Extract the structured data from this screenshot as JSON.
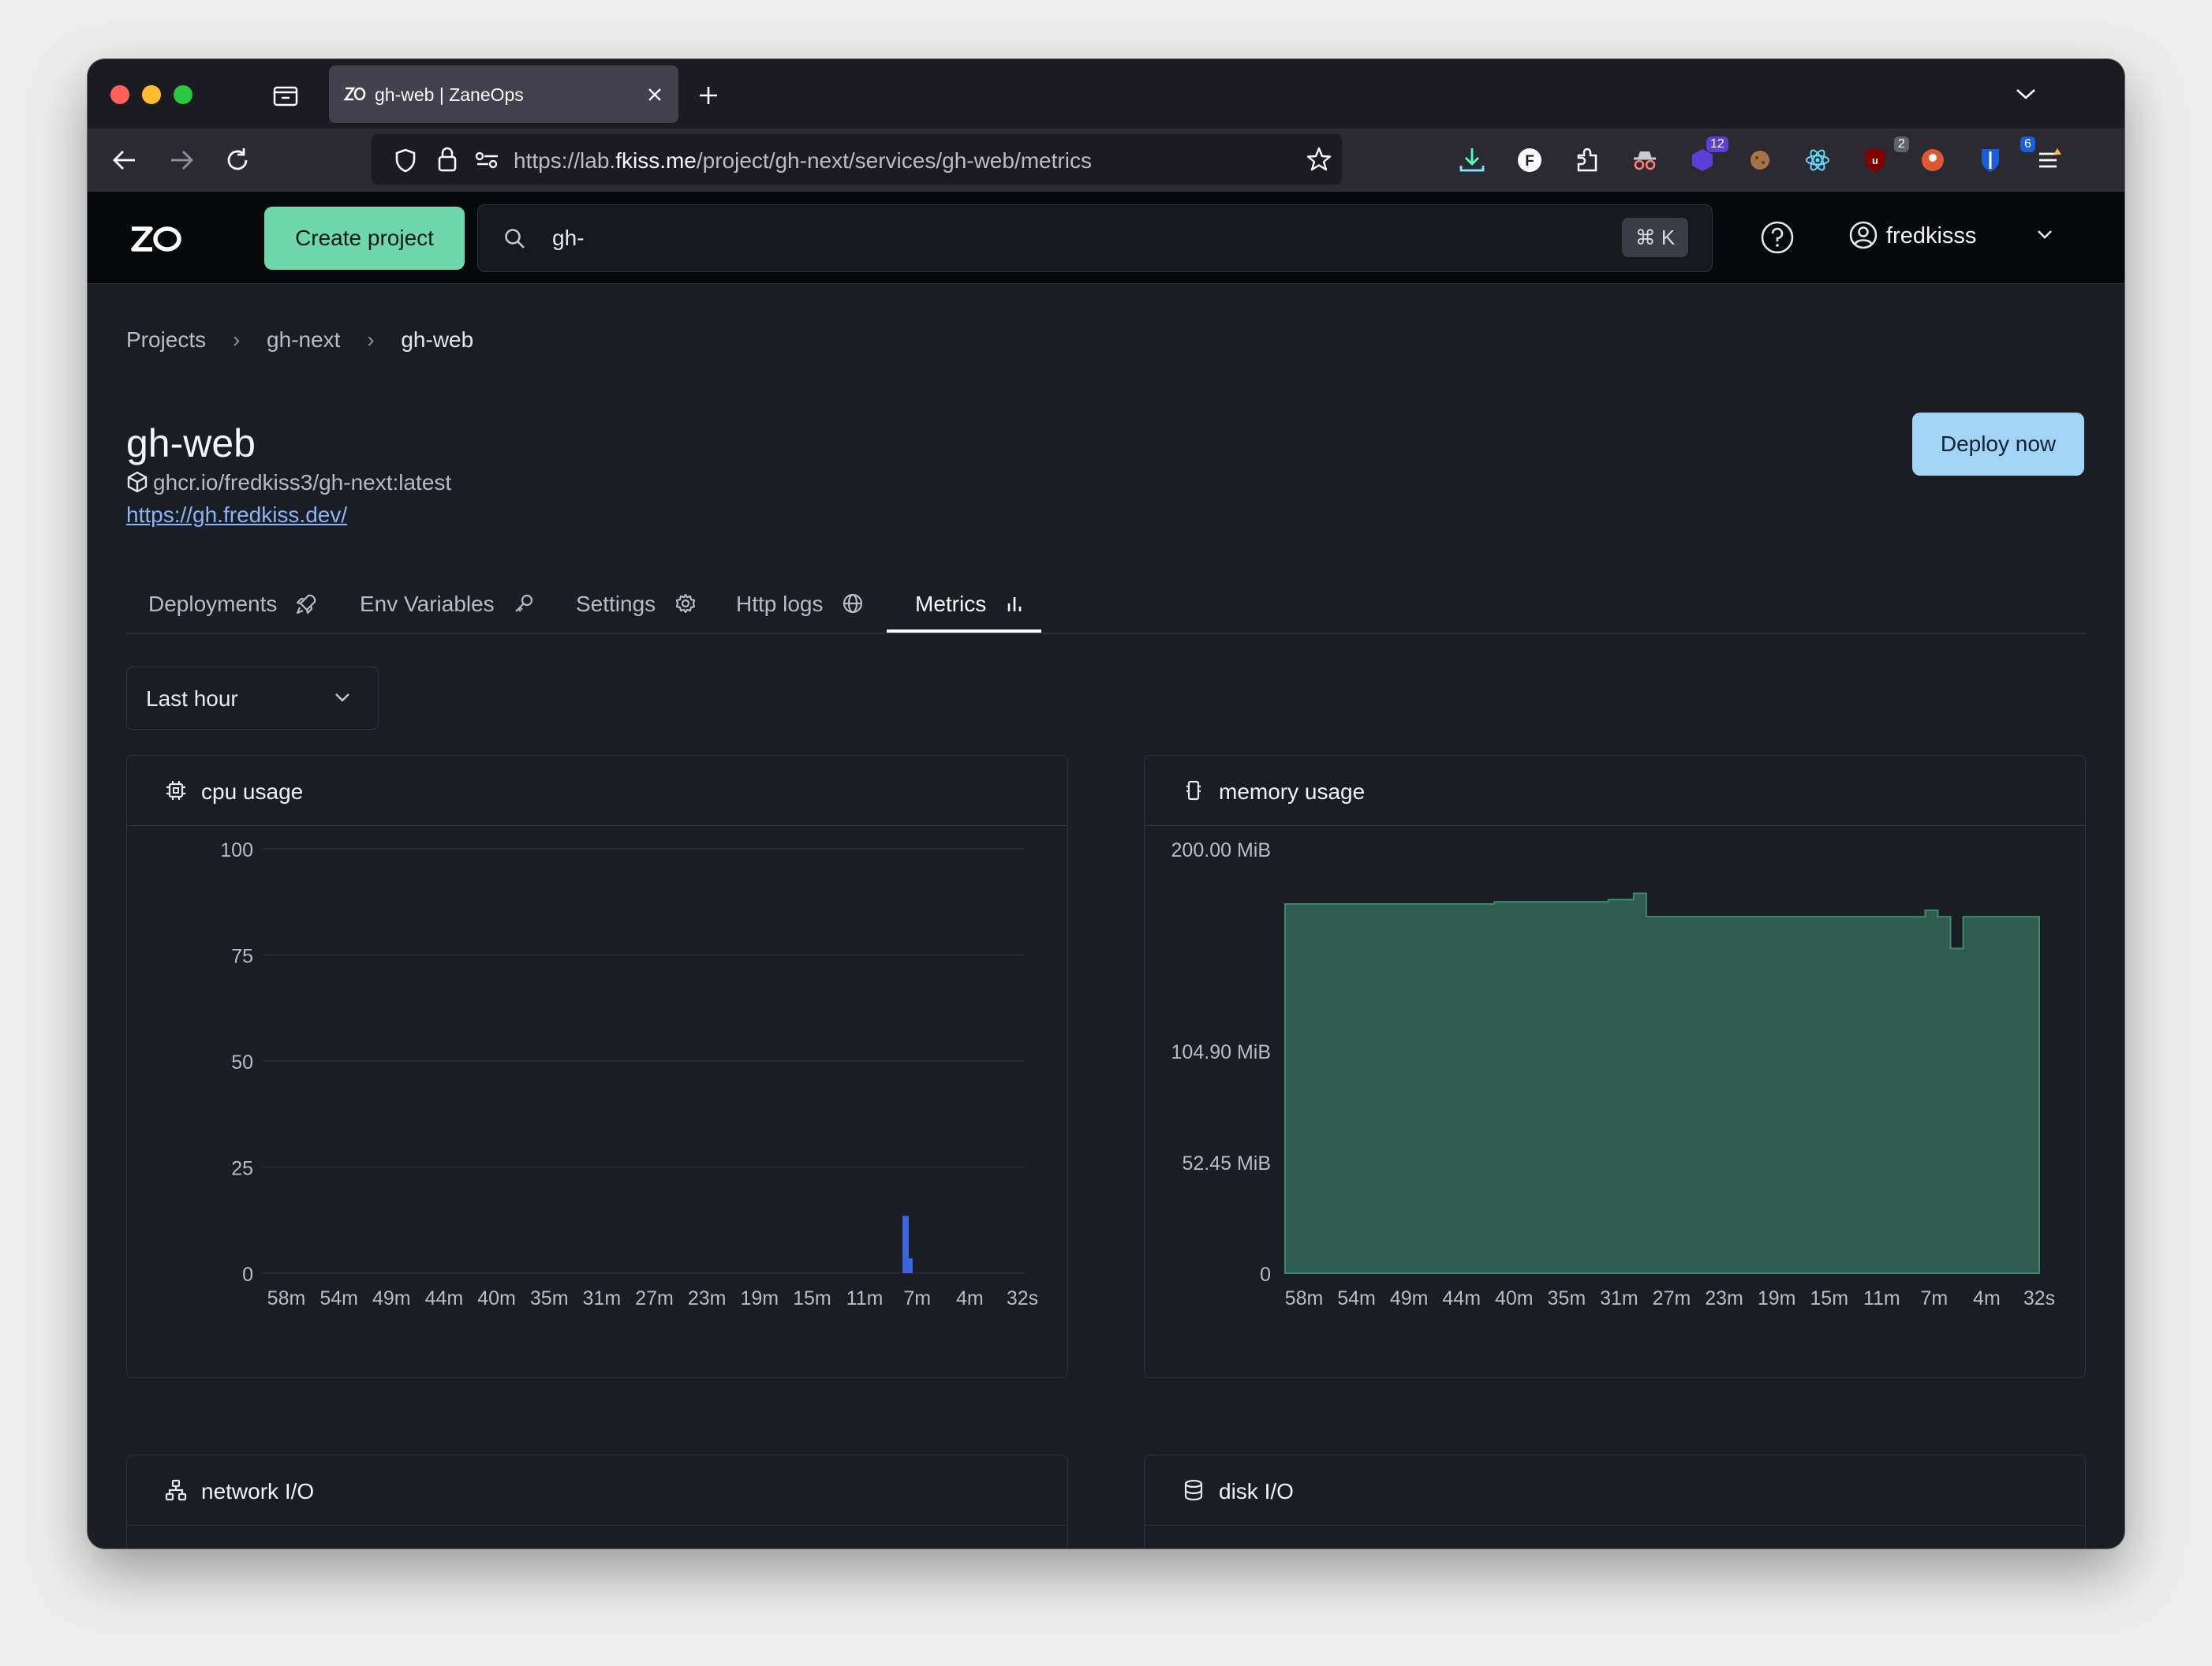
{
  "browser": {
    "tab_title": "gh-web | ZaneOps",
    "url_prefix": "https://lab.",
    "url_host": "fkiss.me",
    "url_path": "/project/gh-next/services/gh-web/metrics",
    "extension_badges": [
      "12",
      "2",
      "6"
    ],
    "colors": {
      "close": "#ff5f57",
      "minimize": "#febc2e",
      "zoom": "#28c840"
    }
  },
  "header": {
    "logo": "ZO",
    "create_project_label": "Create project",
    "search_value": "gh-",
    "search_shortcut": "⌘ K",
    "username": "fredkisss"
  },
  "breadcrumbs": [
    "Projects",
    "gh-next",
    "gh-web"
  ],
  "service": {
    "name": "gh-web",
    "image": "ghcr.io/fredkiss3/gh-next:latest",
    "url": "https://gh.fredkiss.dev/",
    "deploy_label": "Deploy now"
  },
  "tabs": [
    {
      "label": "Deployments",
      "icon": "rocket-icon"
    },
    {
      "label": "Env Variables",
      "icon": "key-icon"
    },
    {
      "label": "Settings",
      "icon": "gear-icon"
    },
    {
      "label": "Http logs",
      "icon": "globe-icon"
    },
    {
      "label": "Metrics",
      "icon": "bar-chart-icon",
      "active": true
    }
  ],
  "time_range": "Last hour",
  "cards": {
    "cpu_title": "cpu usage",
    "memory_title": "memory usage",
    "network_title": "network I/O",
    "disk_title": "disk I/O"
  },
  "chart_data": [
    {
      "type": "bar",
      "title": "cpu usage",
      "x_tick_labels": [
        "58m",
        "54m",
        "49m",
        "44m",
        "40m",
        "35m",
        "31m",
        "27m",
        "23m",
        "19m",
        "15m",
        "11m",
        "7m",
        "4m",
        "32s"
      ],
      "y_tick_labels": [
        "0",
        "25",
        "50",
        "75",
        "100"
      ],
      "ylim": [
        0,
        100
      ],
      "color": "#3d63dd",
      "x_minutes_ago": [
        9.3,
        9.0
      ],
      "values": [
        13.5,
        3.5
      ],
      "grid": true
    },
    {
      "type": "area",
      "title": "memory usage",
      "unit": "MiB",
      "x_tick_labels": [
        "58m",
        "54m",
        "49m",
        "44m",
        "40m",
        "35m",
        "31m",
        "27m",
        "23m",
        "19m",
        "15m",
        "11m",
        "7m",
        "4m",
        "32s"
      ],
      "y_tick_labels": [
        "0",
        "52.45 MiB",
        "104.90 MiB",
        "200.00 MiB"
      ],
      "ytick_values": [
        0,
        52.45,
        104.9,
        200
      ],
      "ylim": [
        0,
        200
      ],
      "color": "#2f5c4f",
      "line_color": "#3c8a6d",
      "x_minutes_ago": [
        59,
        50,
        49,
        43,
        42,
        35,
        34,
        32,
        31,
        30,
        20,
        19,
        10,
        9,
        8,
        7,
        6.5,
        6,
        5,
        0.5
      ],
      "values": [
        174,
        174,
        174,
        175,
        175,
        175,
        176,
        179,
        168,
        168,
        168,
        168,
        168,
        171,
        168,
        153,
        153,
        168,
        168,
        168
      ]
    }
  ]
}
